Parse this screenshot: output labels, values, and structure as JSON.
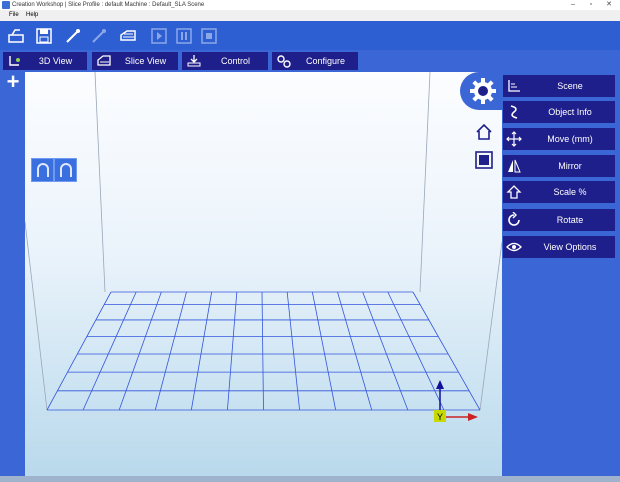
{
  "window": {
    "title": "Creation Workshop  |  Slice Profile : default  Machine : Default_SLA  Scene"
  },
  "menu": {
    "items": [
      "File",
      "Help"
    ]
  },
  "toolbar": {
    "buttons": [
      {
        "icon": "connect-icon",
        "enabled": true
      },
      {
        "icon": "save-icon",
        "enabled": true
      },
      {
        "icon": "pen-icon",
        "enabled": true
      },
      {
        "icon": "pen-disabled-icon",
        "enabled": false
      },
      {
        "icon": "layers-icon",
        "enabled": true
      },
      {
        "icon": "play-icon",
        "enabled": false
      },
      {
        "icon": "pause-icon",
        "enabled": false
      },
      {
        "icon": "stop-icon",
        "enabled": false
      }
    ]
  },
  "tabs": [
    {
      "label": "3D View",
      "icon": "3d-view-icon"
    },
    {
      "label": "Slice View",
      "icon": "slice-view-icon"
    },
    {
      "label": "Control",
      "icon": "control-icon"
    },
    {
      "label": "Configure",
      "icon": "configure-icon"
    }
  ],
  "right_panel": {
    "buttons": [
      {
        "label": "Scene",
        "icon": "scene-icon"
      },
      {
        "label": "Object Info",
        "icon": "object-info-icon"
      },
      {
        "label": "Move (mm)",
        "icon": "move-icon"
      },
      {
        "label": "Mirror",
        "icon": "mirror-icon"
      },
      {
        "label": "Scale %",
        "icon": "scale-icon"
      },
      {
        "label": "Rotate",
        "icon": "rotate-icon"
      },
      {
        "label": "View Options",
        "icon": "eye-icon"
      }
    ]
  },
  "axis": {
    "y_label": "Y"
  },
  "colors": {
    "accent": "#2e5fd2",
    "button_dark": "#1f1f8c",
    "grid": "#3355dd"
  }
}
